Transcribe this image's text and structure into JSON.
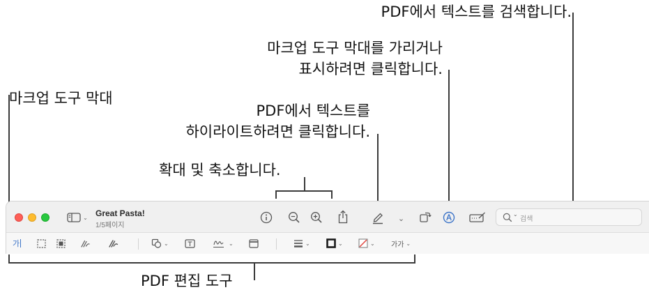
{
  "callouts": {
    "search": "PDF에서 텍스트를 검색합니다.",
    "toggle_markup_line1": "마크업 도구 막대를 가리거나",
    "toggle_markup_line2": "표시하려면 클릭합니다.",
    "markup_toolbar": "마크업 도구 막대",
    "highlight_line1": "PDF에서 텍스트를",
    "highlight_line2": "하이라이트하려면 클릭합니다.",
    "zoom": "확대 및 축소합니다.",
    "pdf_edit_tools": "PDF 편집 도구"
  },
  "window": {
    "title": "Great Pasta!",
    "subtitle": "1/5페이지",
    "search_placeholder": "검색"
  },
  "markup": {
    "text_selection_label": "가",
    "text_style_label": "가가"
  },
  "icons": {
    "toolbar": [
      "sidebar-icon",
      "info-icon",
      "zoom-out-icon",
      "zoom-in-icon",
      "share-icon",
      "highlighter-icon",
      "rotate-icon",
      "markup-icon",
      "form-icon",
      "search-icon"
    ],
    "markup": [
      "text-selection-icon",
      "rectangular-selection-icon",
      "smart-selection-icon",
      "sketch-icon",
      "draw-icon",
      "shapes-icon",
      "text-box-icon",
      "signature-icon",
      "note-icon",
      "line-style-icon",
      "border-color-icon",
      "fill-color-icon",
      "text-style-icon"
    ]
  },
  "colors": {
    "close": "#fe5f57",
    "minimize": "#febc2e",
    "zoom": "#28c840",
    "accent": "#3b73c8",
    "fill_slash": "#e0443e"
  }
}
